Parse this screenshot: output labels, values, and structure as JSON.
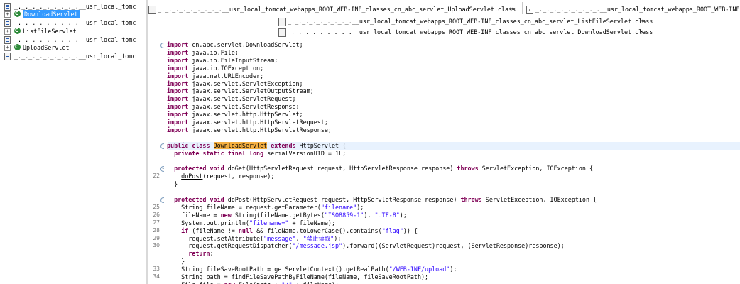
{
  "outline": {
    "items": [
      {
        "label": "_._._._._._._._._.__usr_local_tomc",
        "selected": false,
        "icon": "java-class-file-icon",
        "expander": ""
      },
      {
        "label": "DownloadServlet",
        "selected": true,
        "icon": "class-icon",
        "expander": "+"
      },
      {
        "label": "_._._._._._._._._.__usr_local_tomc",
        "selected": false,
        "icon": "java-class-file-icon",
        "expander": ""
      },
      {
        "label": "ListFileServlet",
        "selected": false,
        "icon": "class-icon",
        "expander": "+"
      },
      {
        "label": "_._._._._._._._._.__usr_local_tomc",
        "selected": false,
        "icon": "java-class-file-icon",
        "expander": ""
      },
      {
        "label": "UploadServlet",
        "selected": false,
        "icon": "class-icon",
        "expander": "+"
      },
      {
        "label": "_._._._._._._._._.__usr_local_tomc",
        "selected": false,
        "icon": "xml-file-icon",
        "expander": ""
      }
    ]
  },
  "tabs": [
    {
      "label": "_._._._._._._._._.__usr_local_tomcat_webapps_ROOT_WEB-INF_classes_cn_abc_servlet_UploadServlet.class",
      "close": "✕"
    },
    {
      "label": "_._._._._._._._._.__usr_local_tomcat_webapps_ROOT_WEB-INF",
      "close": ""
    },
    {
      "label": "_._._._._._._._._.__usr_local_tomcat_webapps_ROOT_WEB-INF_classes_cn_abc_servlet_ListFileServlet.class",
      "close": "✕"
    },
    {
      "label": "_._._._._._._._._.__usr_local_tomcat_webapps_ROOT_WEB-INF_classes_cn_abc_servlet_DownloadServlet.class",
      "close": "✕"
    }
  ],
  "code": {
    "lines": [
      {
        "num": "",
        "fold": "⊖",
        "segments": [
          {
            "t": "import ",
            "c": "kw"
          },
          {
            "t": "cn.abc.servlet.DownloadServlet",
            "c": "ul"
          },
          {
            "t": ";",
            "c": ""
          }
        ]
      },
      {
        "num": "",
        "fold": "",
        "segments": [
          {
            "t": "import ",
            "c": "kw"
          },
          {
            "t": "java.io.File;",
            "c": ""
          }
        ]
      },
      {
        "num": "",
        "fold": "",
        "segments": [
          {
            "t": "import ",
            "c": "kw"
          },
          {
            "t": "java.io.FileInputStream;",
            "c": ""
          }
        ]
      },
      {
        "num": "",
        "fold": "",
        "segments": [
          {
            "t": "import ",
            "c": "kw"
          },
          {
            "t": "java.io.IOException;",
            "c": ""
          }
        ]
      },
      {
        "num": "",
        "fold": "",
        "segments": [
          {
            "t": "import ",
            "c": "kw"
          },
          {
            "t": "java.net.URLEncoder;",
            "c": ""
          }
        ]
      },
      {
        "num": "",
        "fold": "",
        "segments": [
          {
            "t": "import ",
            "c": "kw"
          },
          {
            "t": "javax.servlet.ServletException;",
            "c": ""
          }
        ]
      },
      {
        "num": "",
        "fold": "",
        "segments": [
          {
            "t": "import ",
            "c": "kw"
          },
          {
            "t": "javax.servlet.ServletOutputStream;",
            "c": ""
          }
        ]
      },
      {
        "num": "",
        "fold": "",
        "segments": [
          {
            "t": "import ",
            "c": "kw"
          },
          {
            "t": "javax.servlet.ServletRequest;",
            "c": ""
          }
        ]
      },
      {
        "num": "",
        "fold": "",
        "segments": [
          {
            "t": "import ",
            "c": "kw"
          },
          {
            "t": "javax.servlet.ServletResponse;",
            "c": ""
          }
        ]
      },
      {
        "num": "",
        "fold": "",
        "segments": [
          {
            "t": "import ",
            "c": "kw"
          },
          {
            "t": "javax.servlet.http.HttpServlet;",
            "c": ""
          }
        ]
      },
      {
        "num": "",
        "fold": "",
        "segments": [
          {
            "t": "import ",
            "c": "kw"
          },
          {
            "t": "javax.servlet.http.HttpServletRequest;",
            "c": ""
          }
        ]
      },
      {
        "num": "",
        "fold": "",
        "segments": [
          {
            "t": "import ",
            "c": "kw"
          },
          {
            "t": "javax.servlet.http.HttpServletResponse;",
            "c": ""
          }
        ]
      },
      {
        "num": "",
        "fold": "",
        "segments": []
      },
      {
        "num": "",
        "fold": "⊖",
        "segments": [
          {
            "t": "public class ",
            "c": "kw"
          },
          {
            "t": "DownloadServlet",
            "c": "hl"
          },
          {
            "t": " ",
            "c": ""
          },
          {
            "t": "extends",
            "c": "kw"
          },
          {
            "t": " HttpServlet {",
            "c": ""
          }
        ]
      },
      {
        "num": "",
        "fold": "",
        "segments": [
          {
            "t": "  private static final long ",
            "c": "kw"
          },
          {
            "t": "serialVersionUID = 1L;",
            "c": ""
          }
        ]
      },
      {
        "num": "",
        "fold": "",
        "segments": []
      },
      {
        "num": "",
        "fold": "⊖",
        "segments": [
          {
            "t": "  protected void ",
            "c": "kw"
          },
          {
            "t": "doGet(HttpServletRequest request, HttpServletResponse response) ",
            "c": ""
          },
          {
            "t": "throws",
            "c": "kw"
          },
          {
            "t": " ServletException, IOException {",
            "c": ""
          }
        ]
      },
      {
        "num": "22",
        "fold": "",
        "segments": [
          {
            "t": "    ",
            "c": ""
          },
          {
            "t": "doPost",
            "c": "ul"
          },
          {
            "t": "(request, response);",
            "c": ""
          }
        ]
      },
      {
        "num": "",
        "fold": "",
        "segments": [
          {
            "t": "  }",
            "c": ""
          }
        ]
      },
      {
        "num": "",
        "fold": "",
        "segments": []
      },
      {
        "num": "",
        "fold": "⊖",
        "segments": [
          {
            "t": "  protected void ",
            "c": "kw"
          },
          {
            "t": "doPost(HttpServletRequest request, HttpServletResponse response) ",
            "c": ""
          },
          {
            "t": "throws",
            "c": "kw"
          },
          {
            "t": " ServletException, IOException {",
            "c": ""
          }
        ]
      },
      {
        "num": "25",
        "fold": "",
        "segments": [
          {
            "t": "    String fileName = request.getParameter(",
            "c": ""
          },
          {
            "t": "\"filename\"",
            "c": "str"
          },
          {
            "t": ");",
            "c": ""
          }
        ]
      },
      {
        "num": "26",
        "fold": "",
        "segments": [
          {
            "t": "    fileName = ",
            "c": ""
          },
          {
            "t": "new",
            "c": "kw"
          },
          {
            "t": " String(fileName.getBytes(",
            "c": ""
          },
          {
            "t": "\"ISO8859-1\"",
            "c": "str"
          },
          {
            "t": "), ",
            "c": ""
          },
          {
            "t": "\"UTF-8\"",
            "c": "str"
          },
          {
            "t": ");",
            "c": ""
          }
        ]
      },
      {
        "num": "27",
        "fold": "",
        "segments": [
          {
            "t": "    System.out.println(",
            "c": ""
          },
          {
            "t": "\"filename=\"",
            "c": "str"
          },
          {
            "t": " + fileName);",
            "c": ""
          }
        ]
      },
      {
        "num": "28",
        "fold": "",
        "segments": [
          {
            "t": "    ",
            "c": ""
          },
          {
            "t": "if",
            "c": "kw"
          },
          {
            "t": " (fileName != ",
            "c": ""
          },
          {
            "t": "null",
            "c": "kw"
          },
          {
            "t": " && fileName.toLowerCase().contains(",
            "c": ""
          },
          {
            "t": "\"flag\"",
            "c": "str"
          },
          {
            "t": ")) {",
            "c": ""
          }
        ]
      },
      {
        "num": "29",
        "fold": "",
        "segments": [
          {
            "t": "      request.setAttribute(",
            "c": ""
          },
          {
            "t": "\"message\"",
            "c": "str"
          },
          {
            "t": ", ",
            "c": ""
          },
          {
            "t": "\"禁止读取\"",
            "c": "str"
          },
          {
            "t": ");",
            "c": ""
          }
        ]
      },
      {
        "num": "30",
        "fold": "",
        "segments": [
          {
            "t": "      request.getRequestDispatcher(",
            "c": ""
          },
          {
            "t": "\"/message.jsp\"",
            "c": "str"
          },
          {
            "t": ").forward((ServletRequest)request, (ServletResponse)response);",
            "c": ""
          }
        ]
      },
      {
        "num": "",
        "fold": "",
        "segments": [
          {
            "t": "      ",
            "c": ""
          },
          {
            "t": "return",
            "c": "kw"
          },
          {
            "t": ";",
            "c": ""
          }
        ]
      },
      {
        "num": "",
        "fold": "",
        "segments": [
          {
            "t": "    }",
            "c": ""
          }
        ]
      },
      {
        "num": "33",
        "fold": "",
        "segments": [
          {
            "t": "    String fileSaveRootPath = getServletContext().getRealPath(",
            "c": ""
          },
          {
            "t": "\"/WEB-INF/upload\"",
            "c": "str"
          },
          {
            "t": ");",
            "c": ""
          }
        ]
      },
      {
        "num": "34",
        "fold": "",
        "segments": [
          {
            "t": "    String path = ",
            "c": ""
          },
          {
            "t": "findFileSavePathByFileName",
            "c": "ul"
          },
          {
            "t": "(fileName, fileSaveRootPath);",
            "c": ""
          }
        ]
      },
      {
        "num": "",
        "fold": "",
        "segments": [
          {
            "t": "    File file = ",
            "c": ""
          },
          {
            "t": "new",
            "c": "kw"
          },
          {
            "t": " File(path + ",
            "c": ""
          },
          {
            "t": "\"/\"",
            "c": "str"
          },
          {
            "t": " + fileName);",
            "c": ""
          }
        ]
      }
    ]
  }
}
